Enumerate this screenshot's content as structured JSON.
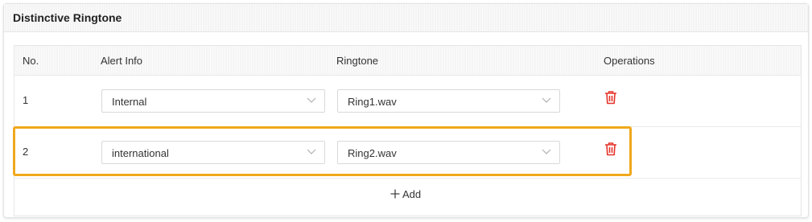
{
  "panel": {
    "title": "Distinctive Ringtone"
  },
  "table": {
    "headers": {
      "no": "No.",
      "alert_info": "Alert Info",
      "ringtone": "Ringtone",
      "operations": "Operations"
    },
    "rows": [
      {
        "no": "1",
        "alert_info": "Internal",
        "ringtone": "Ring1.wav"
      },
      {
        "no": "2",
        "alert_info": "international",
        "ringtone": "Ring2.wav"
      }
    ]
  },
  "add": {
    "label": "Add"
  },
  "colors": {
    "delete_icon": "#e5332a",
    "highlight": "#f0a81c"
  },
  "icons": {
    "delete": "trash-icon",
    "dropdown": "chevron-down-icon",
    "add": "plus-icon"
  }
}
